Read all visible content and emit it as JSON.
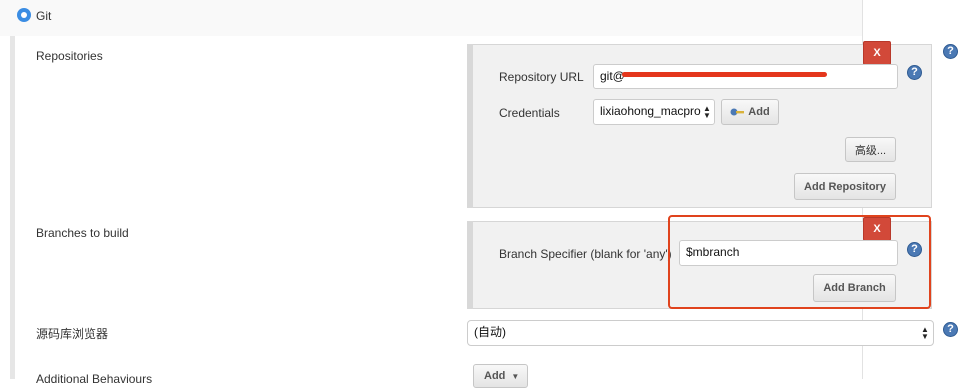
{
  "scm": {
    "git_label": "Git"
  },
  "repositories": {
    "section_label": "Repositories",
    "remove_label": "X",
    "url_label": "Repository URL",
    "url_value": "git@",
    "credentials_label": "Credentials",
    "credentials_value": "lixiaohong_macpro",
    "add_credentials_label": "Add",
    "advanced_label": "高级...",
    "add_repository_label": "Add Repository"
  },
  "branches": {
    "section_label": "Branches to build",
    "remove_label": "X",
    "specifier_label": "Branch Specifier (blank for 'any')",
    "specifier_value": "$mbranch",
    "add_branch_label": "Add Branch"
  },
  "browser": {
    "label": "源码库浏览器",
    "value": "(自动)"
  },
  "behaviours": {
    "label": "Additional Behaviours",
    "add_label": "Add"
  },
  "help_label": "?",
  "colors": {
    "radio": "#3b8de3",
    "remove": "#d24939",
    "highlight": "#e0431d",
    "help": "#4b79b4"
  }
}
